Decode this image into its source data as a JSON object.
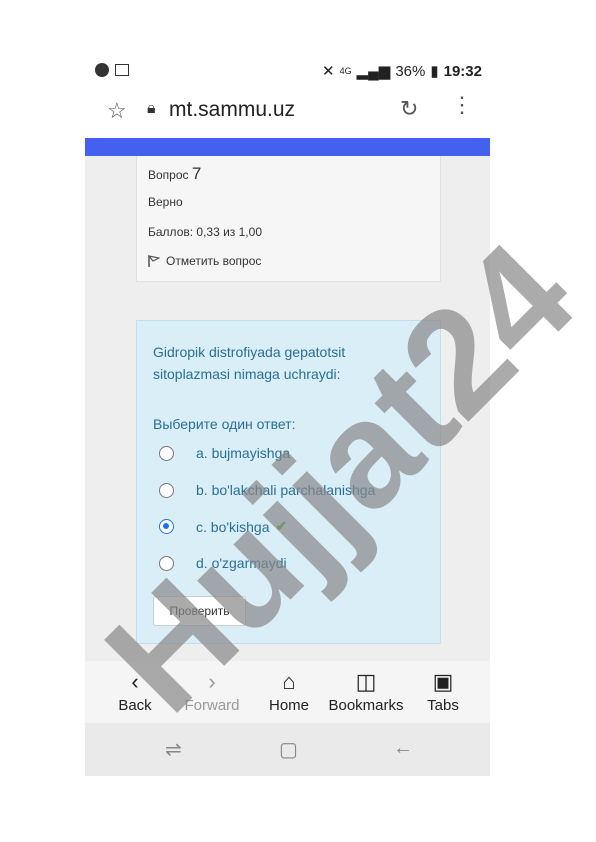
{
  "status": {
    "battery": "36%",
    "time": "19:32",
    "signal": "4G"
  },
  "browser": {
    "url": "mt.sammu.uz"
  },
  "question_info": {
    "label": "Вопрос",
    "number": "7",
    "state": "Верно",
    "mark": "Баллов: 0,33 из 1,00",
    "flag_label": "Отметить вопрос"
  },
  "question": {
    "text": "Gidropik distrofiyada gepatotsit sitoplazmasi nimaga uchraydi:",
    "prompt": "Выберите один ответ:",
    "options": [
      {
        "label": "a. bujmayishga",
        "selected": false
      },
      {
        "label": "b. bo'lakchali parchalanishga",
        "selected": false
      },
      {
        "label": "c. bo'kishga",
        "selected": true,
        "correct": true
      },
      {
        "label": "d. o'zgarmaydi",
        "selected": false
      }
    ],
    "check_button": "Проверить"
  },
  "nav": {
    "back": "Back",
    "forward": "Forward",
    "home": "Home",
    "bookmarks": "Bookmarks",
    "tabs": "Tabs"
  },
  "watermark": "Hujjat24",
  "colors": {
    "accent": "#4361ee",
    "question_bg": "#d9eef7",
    "question_text": "#2a6f93",
    "check": "#5aa832"
  }
}
